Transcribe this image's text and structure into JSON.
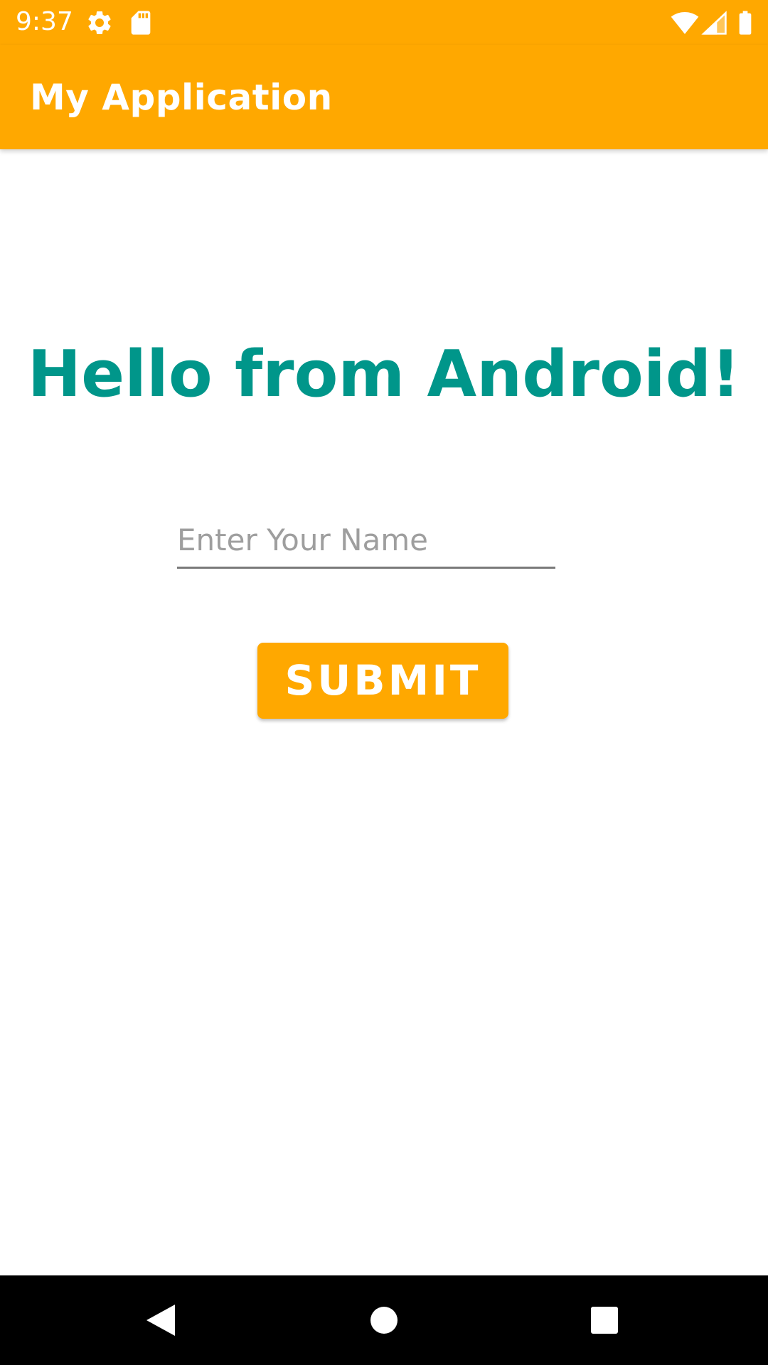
{
  "status_bar": {
    "time": "9:37",
    "icons": [
      "gear-icon",
      "sd-card-icon",
      "wifi-icon",
      "signal-icon",
      "battery-icon"
    ]
  },
  "app_bar": {
    "title": "My Application"
  },
  "main": {
    "greeting": "Hello from Android!",
    "name_input": {
      "value": "",
      "placeholder": "Enter Your Name"
    },
    "submit_label": "SUBMIT"
  },
  "nav_bar": {
    "icons": [
      "back-icon",
      "home-icon",
      "recents-icon"
    ]
  },
  "colors": {
    "primary": "#FFA800",
    "greeting_text": "#00968A",
    "nav_bar": "#000000",
    "background": "#FFFFFF"
  }
}
